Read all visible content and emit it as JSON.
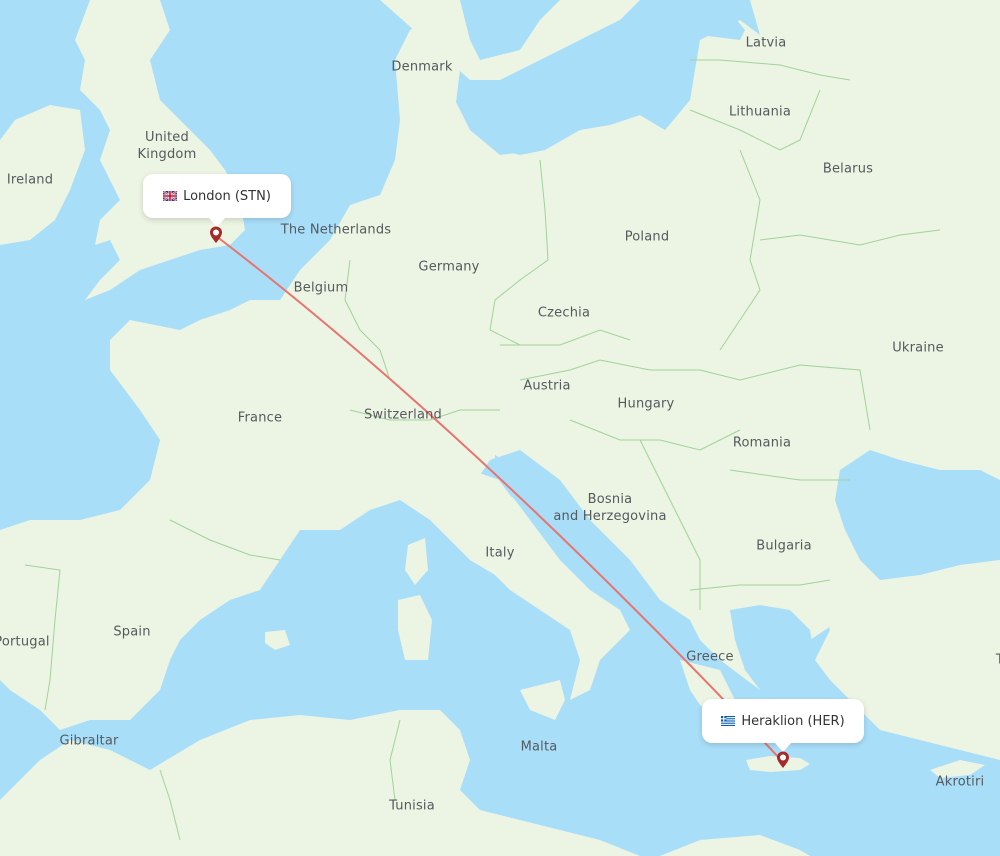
{
  "map": {
    "colors": {
      "water": "#a9def9",
      "land": "#ecf4e3",
      "border": "#9fd39a",
      "route": "#e8736f",
      "pin": "#a52a2a"
    },
    "country_labels": [
      {
        "name": "Ireland"
      },
      {
        "name": "United\nKingdom"
      },
      {
        "name": "Denmark"
      },
      {
        "name": "Latvia"
      },
      {
        "name": "Lithuania"
      },
      {
        "name": "Belarus"
      },
      {
        "name": "The Netherlands"
      },
      {
        "name": "Germany"
      },
      {
        "name": "Poland"
      },
      {
        "name": "Belgium"
      },
      {
        "name": "Czechia"
      },
      {
        "name": "Ukraine"
      },
      {
        "name": "Austria"
      },
      {
        "name": "Hungary"
      },
      {
        "name": "France"
      },
      {
        "name": "Switzerland"
      },
      {
        "name": "Romania"
      },
      {
        "name": "Bosnia\nand Herzegovina"
      },
      {
        "name": "Bulgaria"
      },
      {
        "name": "Italy"
      },
      {
        "name": "Spain"
      },
      {
        "name": "Portugal"
      },
      {
        "name": "Greece"
      },
      {
        "name": "Gibraltar"
      },
      {
        "name": "Malta"
      },
      {
        "name": "Tunisia"
      },
      {
        "name": "Akrotiri"
      },
      {
        "name": "T"
      }
    ],
    "origin": {
      "city": "London",
      "code": "STN",
      "label": "London (STN)",
      "flag": "uk-flag-icon"
    },
    "destination": {
      "city": "Heraklion",
      "code": "HER",
      "label": "Heraklion (HER)",
      "flag": "greece-flag-icon"
    }
  }
}
